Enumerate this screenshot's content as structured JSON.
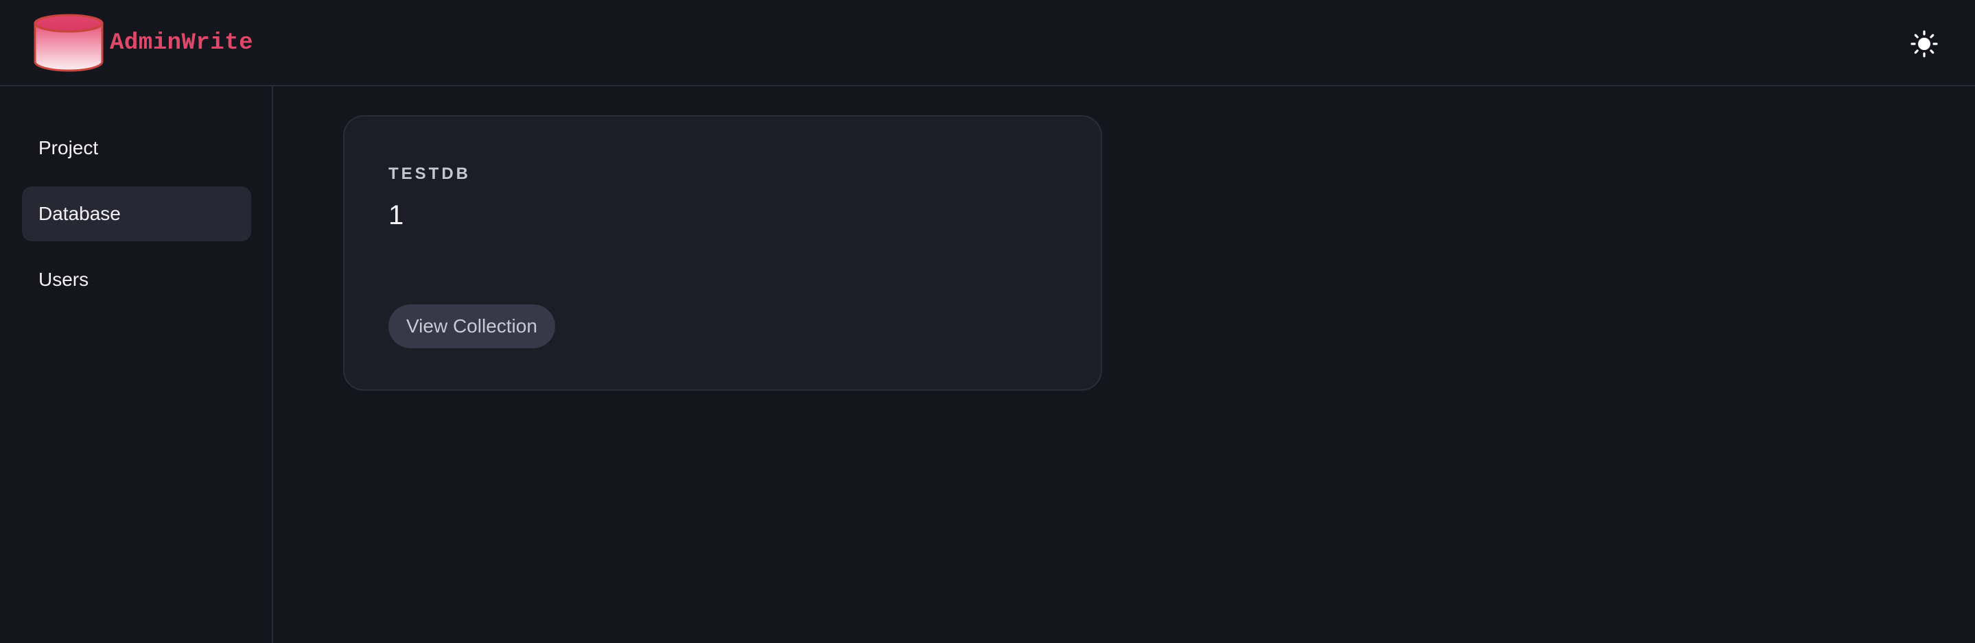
{
  "header": {
    "brand_name": "AdminWrite",
    "theme_toggle_icon": "sun-icon"
  },
  "colors": {
    "background": "#15151e",
    "brand": "#e0486a",
    "card": "#1d1d28",
    "active_nav": "#272834",
    "button": "#373848"
  },
  "sidebar": {
    "items": [
      {
        "label": "Project",
        "active": false
      },
      {
        "label": "Database",
        "active": true
      },
      {
        "label": "Users",
        "active": false
      }
    ]
  },
  "main": {
    "card": {
      "title": "TESTDB",
      "count": "1",
      "button_label": "View Collection"
    }
  }
}
